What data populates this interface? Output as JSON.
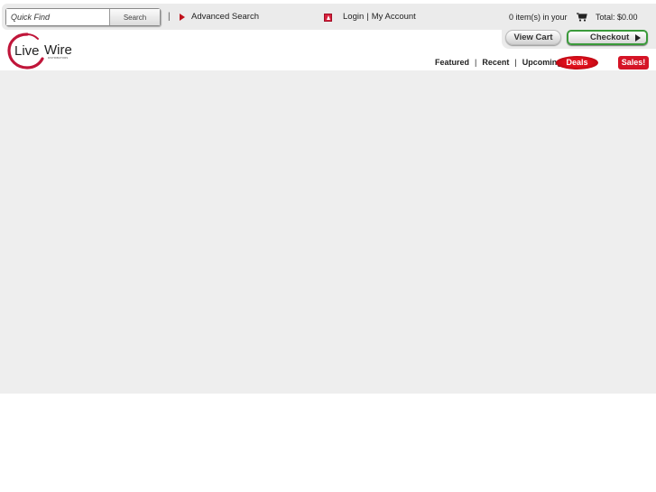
{
  "header": {
    "search": {
      "placeholder": "Quick Find",
      "value": "",
      "button_label": "Search"
    },
    "separator": "|",
    "advanced_search_label": "Advanced Search",
    "account": {
      "login_label": "Login",
      "separator": "|",
      "my_account_label": "My Account"
    },
    "cart": {
      "items_text": "0 item(s) in your",
      "total_text": "Total: $0.00",
      "view_cart_label": "View Cart",
      "checkout_label": "Checkout"
    }
  },
  "logo": {
    "name": "LiveWire",
    "tagline": "DISTRIBUTORS",
    "accent_color": "#c0163a"
  },
  "nav": {
    "items": [
      {
        "label": "Featured"
      },
      {
        "label": "Recent"
      },
      {
        "label": "Upcoming"
      }
    ],
    "separator": "|",
    "deals_badge": "Deals",
    "sales_badge": "Sales!"
  },
  "colors": {
    "accent_red": "#d51426",
    "checkout_green": "#3a9a3a",
    "header_bg": "#ebebeb",
    "content_bg": "#eeeeee"
  }
}
